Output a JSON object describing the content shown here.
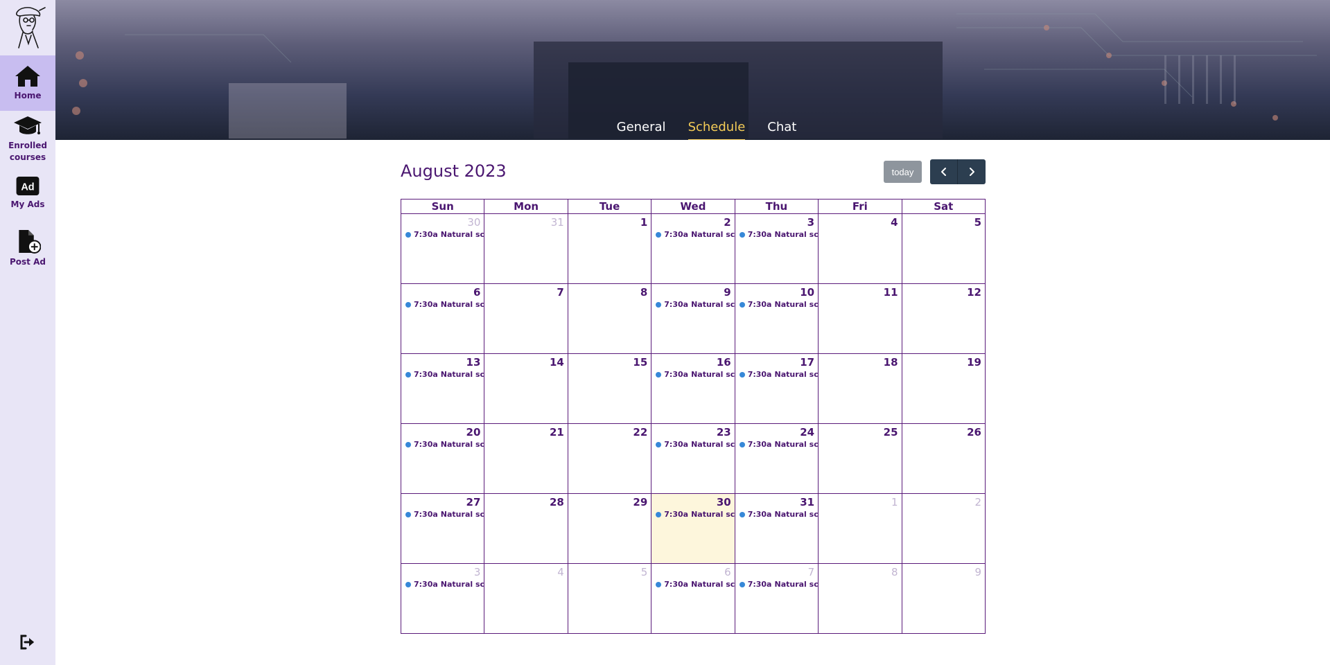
{
  "sidebar": {
    "items": [
      {
        "label": "Home",
        "icon": "home-icon",
        "active": true
      },
      {
        "label": "Enrolled courses",
        "icon": "graduation-cap-icon",
        "active": false
      },
      {
        "label": "My Ads",
        "icon": "ad-icon",
        "active": false
      },
      {
        "label": "Post Ad",
        "icon": "file-plus-icon",
        "active": false
      }
    ],
    "logout_icon": "sign-out-icon"
  },
  "tabs": [
    {
      "label": "General",
      "active": false
    },
    {
      "label": "Schedule",
      "active": true
    },
    {
      "label": "Chat",
      "active": false
    }
  ],
  "calendar": {
    "title": "August 2023",
    "today_label": "today",
    "weekdays": [
      "Sun",
      "Mon",
      "Tue",
      "Wed",
      "Thu",
      "Fri",
      "Sat"
    ],
    "weeks": [
      [
        {
          "d": "30",
          "o": true,
          "e": true
        },
        {
          "d": "31",
          "o": true
        },
        {
          "d": "1"
        },
        {
          "d": "2",
          "e": true
        },
        {
          "d": "3",
          "e": true
        },
        {
          "d": "4"
        },
        {
          "d": "5"
        }
      ],
      [
        {
          "d": "6",
          "e": true
        },
        {
          "d": "7"
        },
        {
          "d": "8"
        },
        {
          "d": "9",
          "e": true
        },
        {
          "d": "10",
          "e": true
        },
        {
          "d": "11"
        },
        {
          "d": "12"
        }
      ],
      [
        {
          "d": "13",
          "e": true
        },
        {
          "d": "14"
        },
        {
          "d": "15"
        },
        {
          "d": "16",
          "e": true
        },
        {
          "d": "17",
          "e": true
        },
        {
          "d": "18"
        },
        {
          "d": "19"
        }
      ],
      [
        {
          "d": "20",
          "e": true
        },
        {
          "d": "21"
        },
        {
          "d": "22"
        },
        {
          "d": "23",
          "e": true
        },
        {
          "d": "24",
          "e": true
        },
        {
          "d": "25"
        },
        {
          "d": "26"
        }
      ],
      [
        {
          "d": "27",
          "e": true
        },
        {
          "d": "28"
        },
        {
          "d": "29"
        },
        {
          "d": "30",
          "e": true,
          "t": true
        },
        {
          "d": "31",
          "e": true
        },
        {
          "d": "1",
          "o": true
        },
        {
          "d": "2",
          "o": true
        }
      ],
      [
        {
          "d": "3",
          "o": true,
          "e": true
        },
        {
          "d": "4",
          "o": true
        },
        {
          "d": "5",
          "o": true
        },
        {
          "d": "6",
          "o": true,
          "e": true
        },
        {
          "d": "7",
          "o": true,
          "e": true
        },
        {
          "d": "8",
          "o": true
        },
        {
          "d": "9",
          "o": true
        }
      ]
    ],
    "event": {
      "time": "7:30a",
      "title": "Natural sci"
    }
  },
  "colors": {
    "accent": "#4a1670",
    "active_tab": "#f4cc57",
    "event_dot": "#3788d8",
    "today_bg": "#fdf6dc",
    "sidebar_bg": "#e8e5f6"
  }
}
